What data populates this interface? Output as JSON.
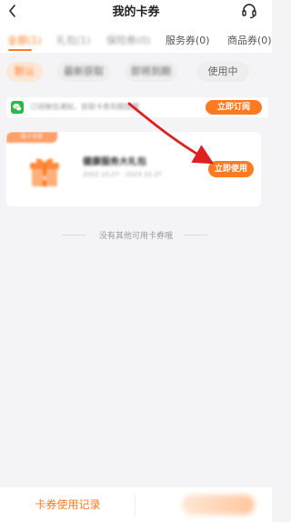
{
  "header": {
    "title": "我的卡券",
    "back_icon": "chevron-left-icon",
    "support_icon": "headset-icon"
  },
  "tabs": [
    {
      "label": "全部(1)",
      "active": true
    },
    {
      "label": "礼包(1)",
      "active": false
    },
    {
      "label": "保险券(0)",
      "active": false
    },
    {
      "label": "服务券(0)",
      "active": false
    },
    {
      "label": "商品券(0)",
      "active": false
    }
  ],
  "filters": [
    {
      "label": "默认",
      "active": true
    },
    {
      "label": "最新获取",
      "active": false
    },
    {
      "label": "即将到期",
      "active": false
    },
    {
      "label": "使用中",
      "active": false
    }
  ],
  "notice": {
    "icon": "wechat-icon",
    "text": "订阅微信通知，获取卡券到期提醒",
    "button_label": "立即订阅"
  },
  "coupon": {
    "badge": "新人专享",
    "title": "健康服务大礼包",
    "date": "2022.10.27 - 2023.10.27",
    "icon": "gift-box-icon",
    "button_label": "立即使用"
  },
  "empty_hint": "没有其他可用卡券哦",
  "footer": {
    "history_label": "卡券使用记录"
  },
  "colors": {
    "accent": "#ff7a21",
    "background": "#f4f4f6",
    "arrow": "#e02020"
  }
}
